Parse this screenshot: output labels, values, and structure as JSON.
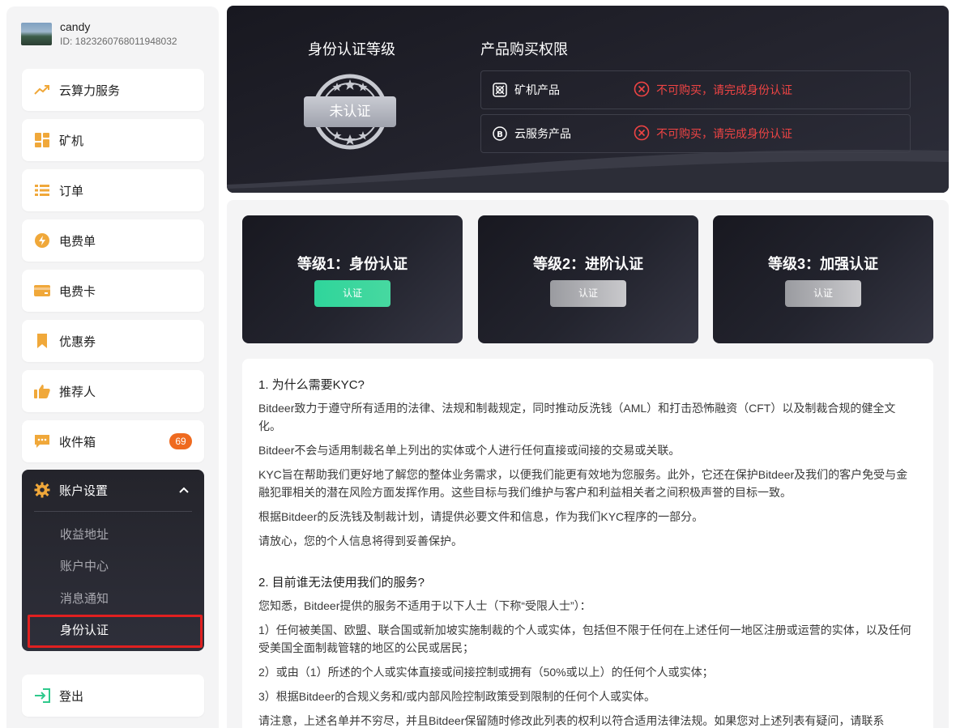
{
  "user": {
    "name": "candy",
    "id": "ID: 1823260768011948032"
  },
  "menu": [
    {
      "label": "云算力服务"
    },
    {
      "label": "矿机"
    },
    {
      "label": "订单"
    },
    {
      "label": "电费单"
    },
    {
      "label": "电费卡"
    },
    {
      "label": "优惠券"
    },
    {
      "label": "推荐人"
    },
    {
      "label": "收件箱",
      "badge": "69"
    }
  ],
  "account": {
    "label": "账户设置",
    "sub": [
      "收益地址",
      "账户中心",
      "消息通知",
      "身份认证"
    ]
  },
  "logout": "登出",
  "hero": {
    "level_title": "身份认证等级",
    "status": "未认证",
    "perm_title": "产品购买权限",
    "perms": [
      {
        "name": "矿机产品",
        "status": "不可购买，请完成身份认证"
      },
      {
        "name": "云服务产品",
        "status": "不可购买，请完成身份认证"
      }
    ]
  },
  "levels": [
    {
      "title": "等级1：身份认证",
      "button": "认证"
    },
    {
      "title": "等级2：进阶认证",
      "button": "认证"
    },
    {
      "title": "等级3：加强认证",
      "button": "认证"
    }
  ],
  "article": {
    "s1_title": "1. 为什么需要KYC?",
    "s1_p1": "Bitdeer致力于遵守所有适用的法律、法规和制裁规定，同时推动反洗钱（AML）和打击恐怖融资（CFT）以及制裁合规的健全文化。",
    "s1_p2": "Bitdeer不会与适用制裁名单上列出的实体或个人进行任何直接或间接的交易或关联。",
    "s1_p3": "KYC旨在帮助我们更好地了解您的整体业务需求，以便我们能更有效地为您服务。此外，它还在保护Bitdeer及我们的客户免受与金融犯罪相关的潜在风险方面发挥作用。这些目标与我们维护与客户和利益相关者之间积极声誉的目标一致。",
    "s1_p4": "根据Bitdeer的反洗钱及制裁计划，请提供必要文件和信息，作为我们KYC程序的一部分。",
    "s1_p5": "请放心，您的个人信息将得到妥善保护。",
    "s2_title": "2. 目前谁无法使用我们的服务?",
    "s2_p1": "您知悉，Bitdeer提供的服务不适用于以下人士（下称“受限人士”）：",
    "s2_p2": "1）任何被美国、欧盟、联合国或新加坡实施制裁的个人或实体，包括但不限于任何在上述任何一地区注册或运营的实体，以及任何受美国全面制裁管辖的地区的公民或居民；",
    "s2_p3": "2）或由（1）所述的个人或实体直接或间接控制或拥有（50%或以上）的任何个人或实体；",
    "s2_p4": "3）根据Bitdeer的合规义务和/或内部风险控制政策受到限制的任何个人或实体。",
    "s2_p5": "请注意，上述名单并不穷尽，并且Bitdeer保留随时修改此列表的权利以符合适用法律法规。如果您对上述列表有疑问，请联系"
  }
}
